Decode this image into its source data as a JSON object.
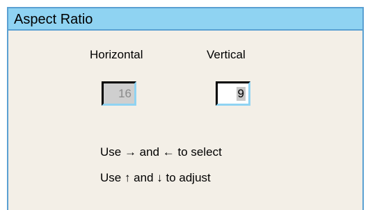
{
  "dialog": {
    "title": "Aspect Ratio"
  },
  "columns": {
    "horizontal_label": "Horizontal",
    "vertical_label": "Vertical"
  },
  "fields": {
    "horizontal_value": "16",
    "vertical_value": "9"
  },
  "hints": {
    "line1": "Use → and ← to select",
    "line2": "Use ↑ and ↓ to adjust"
  },
  "colors": {
    "titlebar": "#8fd3f2",
    "border_accent": "#5aa0d2",
    "panel_background": "#f3efe7",
    "disabled_field": "#cfcfcf"
  }
}
